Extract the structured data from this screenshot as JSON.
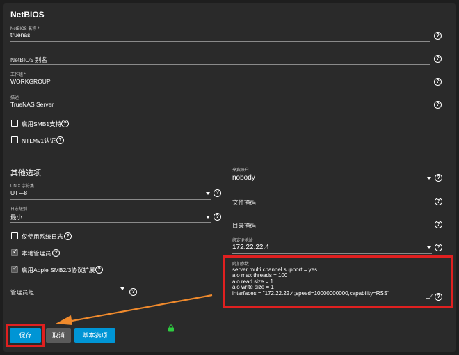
{
  "netbios": {
    "section_title": "NetBIOS",
    "name_label": "NetBIOS 名称 *",
    "name_value": "truenas",
    "alias_placeholder": "NetBIOS 别名",
    "workgroup_label": "工作组 *",
    "workgroup_value": "WORKGROUP",
    "description_label": "描述",
    "description_value": "TrueNAS Server",
    "smb1_label": "启用SMB1支持",
    "ntlmv1_label": "NTLMv1认证"
  },
  "other": {
    "section_title": "其他选项",
    "unix_charset_label": "UNIX 字符集",
    "unix_charset_value": "UTF-8",
    "log_level_label": "日志级别",
    "log_level_value": "最小",
    "syslog_only_label": "仅使用系统日志",
    "syslog_only_checked": false,
    "local_master_label": "本地管理员",
    "local_master_checked": true,
    "apple_ext_label": "启用Apple SMB2/3协议扩展",
    "apple_ext_checked": true,
    "admin_group_placeholder": "管理员组",
    "guest_account_label": "来宾账户",
    "guest_account_value": "nobody",
    "file_mask_placeholder": "文件掩码",
    "dir_mask_placeholder": "目录掩码",
    "bind_ip_label": "绑定IP地址",
    "bind_ip_value": "172.22.22.4",
    "aux_params_label": "附加参数",
    "aux_params_lines": [
      "server multi channel support = yes",
      "aio max threads = 100",
      "aio read size = 1",
      "aio write size = 1",
      "interfaces = \"172.22.22.4;speed=10000000000,capability=RSS\""
    ]
  },
  "buttons": {
    "save": "保存",
    "cancel": "取消",
    "basic": "基本选项"
  },
  "icons": {
    "help": "?",
    "lock": "🔒"
  },
  "colors": {
    "primary": "#0095d5",
    "highlight": "#e02020",
    "arrow": "#f08a2c",
    "lock": "#2ecc40"
  }
}
